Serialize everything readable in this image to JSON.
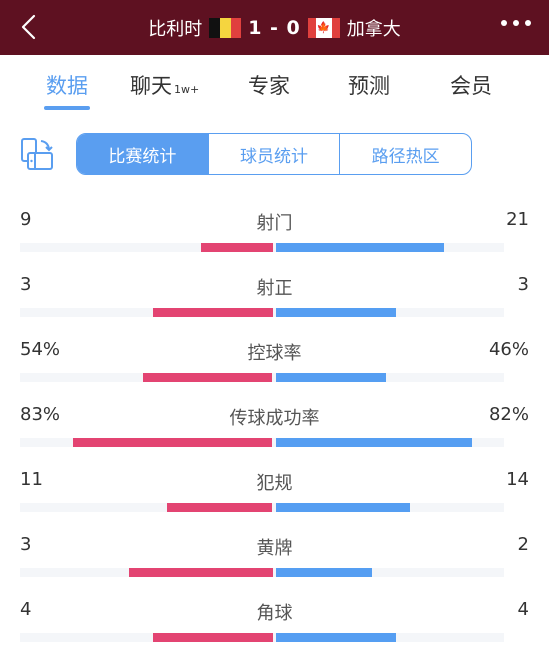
{
  "header": {
    "home_team": "比利时",
    "away_team": "加拿大",
    "score": "1 - 0",
    "home_flag": "belgium-flag",
    "away_flag": "canada-flag",
    "back_icon": "chevron-left-icon",
    "more_icon": "more-dots-icon"
  },
  "tabs": [
    {
      "label": "数据",
      "badge": "",
      "active": true
    },
    {
      "label": "聊天",
      "badge": "1w+",
      "active": false
    },
    {
      "label": "专家",
      "badge": "",
      "active": false
    },
    {
      "label": "预测",
      "badge": "",
      "active": false
    },
    {
      "label": "会员",
      "badge": "",
      "active": false
    }
  ],
  "subnav": {
    "swap_icon": "swap-orientation-icon",
    "segments": [
      {
        "label": "比赛统计",
        "active": true
      },
      {
        "label": "球员统计",
        "active": false
      },
      {
        "label": "路径热区",
        "active": false
      }
    ]
  },
  "colors": {
    "header_bg": "#5e1121",
    "accent": "#5a9ef0",
    "home_bar": "#e34472",
    "away_bar": "#559ef2",
    "track": "#f4f6f9"
  },
  "stats": [
    {
      "label": "射门",
      "home": "9",
      "away": "21",
      "home_frac": 0.3,
      "away_frac": 0.7
    },
    {
      "label": "射正",
      "home": "3",
      "away": "3",
      "home_frac": 0.5,
      "away_frac": 0.5
    },
    {
      "label": "控球率",
      "home": "54%",
      "away": "46%",
      "home_frac": 0.54,
      "away_frac": 0.46
    },
    {
      "label": "传球成功率",
      "home": "83%",
      "away": "82%",
      "home_frac": 0.83,
      "away_frac": 0.82
    },
    {
      "label": "犯规",
      "home": "11",
      "away": "14",
      "home_frac": 0.44,
      "away_frac": 0.56
    },
    {
      "label": "黄牌",
      "home": "3",
      "away": "2",
      "home_frac": 0.6,
      "away_frac": 0.4
    },
    {
      "label": "角球",
      "home": "4",
      "away": "4",
      "home_frac": 0.5,
      "away_frac": 0.5
    }
  ]
}
